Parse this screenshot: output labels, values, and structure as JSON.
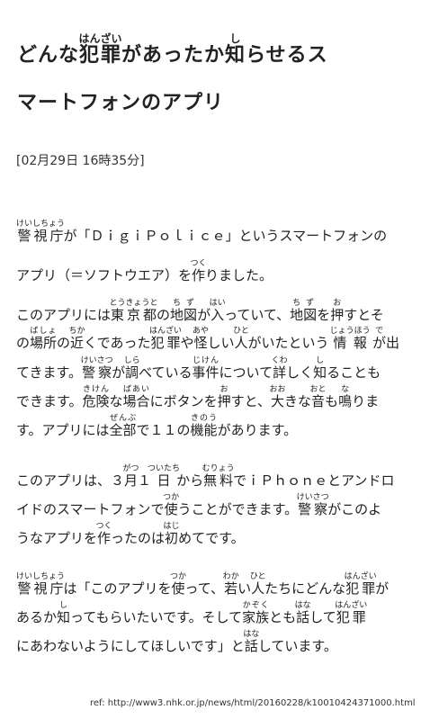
{
  "title": {
    "line1": [
      {
        "t": "どんな"
      },
      {
        "t": "犯罪",
        "r": "はんざい"
      },
      {
        "t": "があったか"
      },
      {
        "t": "知",
        "r": "し"
      },
      {
        "t": "らせるス"
      }
    ],
    "line2": [
      {
        "t": "マートフォンのアプリ"
      }
    ]
  },
  "date": "[02月29日 16時35分]",
  "paragraphs": [
    [
      [
        {
          "t": " "
        },
        {
          "t": "警視庁",
          "r": "けいしちょう"
        },
        {
          "t": "が「ＤｉｇｉＰｏｌｉｃｅ」というスマートフォンの"
        }
      ],
      [
        {
          "t": "アプリ（＝ソフトウエア）を"
        },
        {
          "t": "作",
          "r": "つく"
        },
        {
          "t": "りました。"
        }
      ]
    ],
    [
      [
        {
          "t": "このアプリには"
        },
        {
          "t": "東京都",
          "r": "とうきょうと"
        },
        {
          "t": "の"
        },
        {
          "t": "地図",
          "r": "ちず"
        },
        {
          "t": "が"
        },
        {
          "t": "入",
          "r": "はい"
        },
        {
          "t": "っていて、"
        },
        {
          "t": "地図",
          "r": "ちず"
        },
        {
          "t": "を"
        },
        {
          "t": "押",
          "r": "お"
        },
        {
          "t": "すとそ"
        }
      ],
      [
        {
          "t": "の"
        },
        {
          "t": "場所",
          "r": "ばしょ"
        },
        {
          "t": "の"
        },
        {
          "t": "近",
          "r": "ちか"
        },
        {
          "t": "くであった"
        },
        {
          "t": "犯罪",
          "r": "はんざい"
        },
        {
          "t": "や"
        },
        {
          "t": "怪",
          "r": "あや"
        },
        {
          "t": "しい"
        },
        {
          "t": "人",
          "r": "ひと"
        },
        {
          "t": "がいたという "
        },
        {
          "t": "情報",
          "r": "じょうほう"
        },
        {
          "t": " "
        },
        {
          "t": "が",
          "r": "で"
        },
        {
          "t": "出"
        }
      ],
      [
        {
          "t": "てきます。"
        },
        {
          "t": "警察",
          "r": "けいさつ"
        },
        {
          "t": "が"
        },
        {
          "t": "調",
          "r": "しら"
        },
        {
          "t": "べている"
        },
        {
          "t": "事件",
          "r": "じけん"
        },
        {
          "t": "について"
        },
        {
          "t": "詳",
          "r": "くわ"
        },
        {
          "t": "しく"
        },
        {
          "t": "知",
          "r": "し"
        },
        {
          "t": "ることも"
        }
      ],
      [
        {
          "t": "できます。"
        },
        {
          "t": "危険",
          "r": "きけん"
        },
        {
          "t": "な"
        },
        {
          "t": "場合",
          "r": "ばあい"
        },
        {
          "t": "にボタンを"
        },
        {
          "t": "押",
          "r": "お"
        },
        {
          "t": "すと、"
        },
        {
          "t": "大",
          "r": "おお"
        },
        {
          "t": "きな"
        },
        {
          "t": "音",
          "r": "おと"
        },
        {
          "t": "も"
        },
        {
          "t": "鳴",
          "r": "な"
        },
        {
          "t": "りま"
        }
      ],
      [
        {
          "t": "す。アプリには"
        },
        {
          "t": "全部",
          "r": "ぜんぶ"
        },
        {
          "t": "で１１の"
        },
        {
          "t": "機能",
          "r": "きのう"
        },
        {
          "t": "があります。"
        }
      ]
    ],
    [
      [
        {
          "t": "このアプリは、３"
        },
        {
          "t": "月",
          "r": "がつ"
        },
        {
          "t": "１"
        },
        {
          "t": "日",
          "r": "ついたち"
        },
        {
          "t": "から"
        },
        {
          "t": "無料",
          "r": "むりょう"
        },
        {
          "t": "でｉＰｈｏｎｅとアンドロ"
        }
      ],
      [
        {
          "t": "イドのスマートフォンで"
        },
        {
          "t": "使",
          "r": "つか"
        },
        {
          "t": "うことができます。"
        },
        {
          "t": "警察",
          "r": "けいさつ"
        },
        {
          "t": "がこのよ"
        }
      ],
      [
        {
          "t": "うなアプリを"
        },
        {
          "t": "作",
          "r": "つく"
        },
        {
          "t": "ったのは"
        },
        {
          "t": "初",
          "r": "はじ"
        },
        {
          "t": "めてです。"
        }
      ]
    ],
    [
      [
        {
          "t": " "
        },
        {
          "t": "警視庁",
          "r": "けいしちょう"
        },
        {
          "t": "は「このアプリを"
        },
        {
          "t": "使",
          "r": "つか"
        },
        {
          "t": "って、"
        },
        {
          "t": "若",
          "r": "わか"
        },
        {
          "t": "い"
        },
        {
          "t": "人",
          "r": "ひと"
        },
        {
          "t": "たちにどんな"
        },
        {
          "t": "犯罪",
          "r": "はんざい"
        },
        {
          "t": "が"
        }
      ],
      [
        {
          "t": "あるか"
        },
        {
          "t": "知",
          "r": "し"
        },
        {
          "t": "ってもらいたいです。そして"
        },
        {
          "t": "家族",
          "r": "かぞく"
        },
        {
          "t": "とも"
        },
        {
          "t": "話",
          "r": "はな"
        },
        {
          "t": "して"
        },
        {
          "t": "犯罪",
          "r": "はんざい"
        }
      ],
      [
        {
          "t": "にあわないようにしてほしいです」と"
        },
        {
          "t": "話",
          "r": "はな"
        },
        {
          "t": "しています。"
        }
      ]
    ]
  ],
  "ref": "ref: http://www3.nhk.or.jp/news/html/20160228/k10010424371000.html"
}
